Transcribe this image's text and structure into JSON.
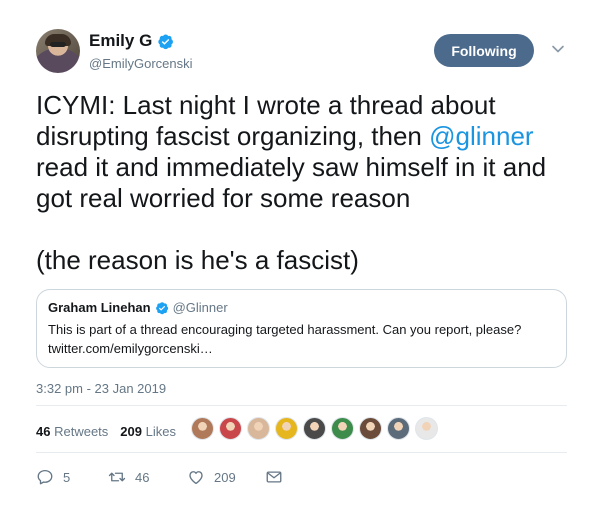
{
  "author": {
    "display_name": "Emily G",
    "handle": "@EmilyGorcenski",
    "verified": true
  },
  "follow_button": {
    "label": "Following"
  },
  "menu": {
    "icon": "chevron-down-icon"
  },
  "tweet": {
    "lines": [
      {
        "before": "ICYMI: Last night I wrote a thread about"
      },
      {
        "before": "disrupting fascist organizing, then ",
        "mention": "@glinner"
      },
      {
        "before": "read it and immediately saw himself in it and"
      },
      {
        "before": "got real worried for some reason"
      }
    ],
    "closing": "(the reason is he's a fascist)"
  },
  "quoted_tweet": {
    "display_name": "Graham Linehan",
    "handle": "@Glinner",
    "verified": true,
    "text_line1": "This is part of a thread encouraging targeted harassment. Can you report, please?",
    "text_line2": "twitter.com/emilygorcenski…"
  },
  "timestamp": "3:32 pm - 23 Jan 2019",
  "stats": {
    "retweets_count": "46",
    "retweets_label": "Retweets",
    "likes_count": "209",
    "likes_label": "Likes"
  },
  "liker_avatars": [
    {
      "name": "liker-avatar-1",
      "color": "#b07a5a"
    },
    {
      "name": "liker-avatar-2",
      "color": "#c9474b"
    },
    {
      "name": "liker-avatar-3",
      "color": "#d8b79a"
    },
    {
      "name": "liker-avatar-4",
      "color": "#e6b61f"
    },
    {
      "name": "liker-avatar-5",
      "color": "#4a4a4a"
    },
    {
      "name": "liker-avatar-6",
      "color": "#3d8c4b"
    },
    {
      "name": "liker-avatar-7",
      "color": "#6b4b3a"
    },
    {
      "name": "liker-avatar-8",
      "color": "#5c6b7a"
    },
    {
      "name": "liker-avatar-9",
      "color": "#e8e8e8"
    }
  ],
  "actions": {
    "reply_count": "5",
    "retweet_count": "46",
    "like_count": "209"
  },
  "colors": {
    "accent": "#1da1f2",
    "follow_button": "#4b6a8c",
    "mention": "#1b95e0",
    "muted": "#657786"
  }
}
